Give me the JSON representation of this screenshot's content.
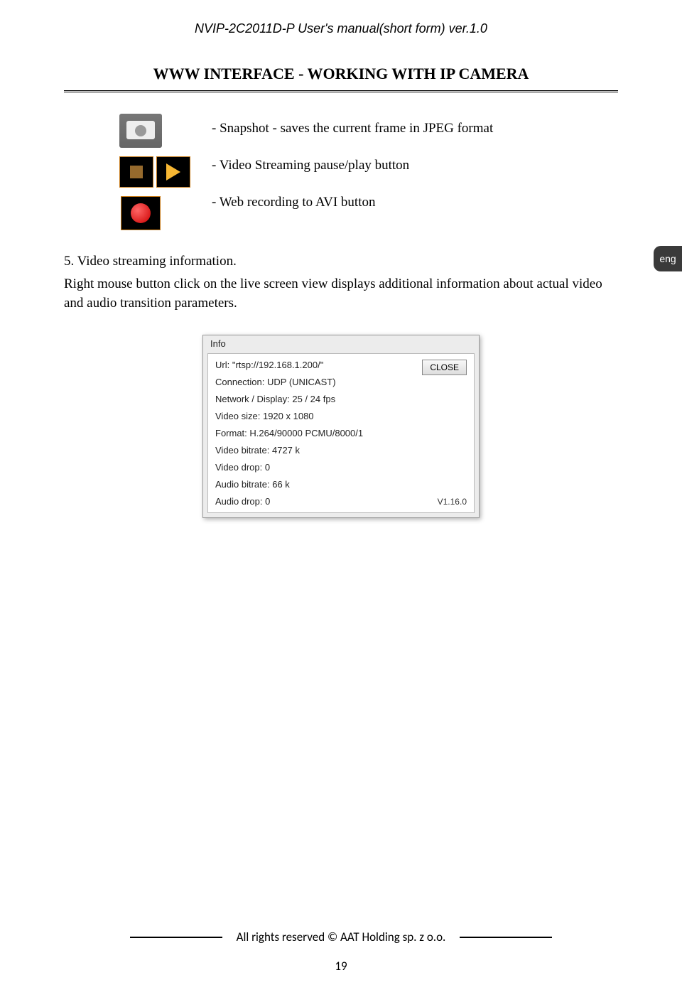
{
  "header": {
    "title": "NVIP-2C2011D-P User's manual(short form) ver.1.0"
  },
  "section": {
    "title": "WWW INTERFACE - WORKING WITH IP CAMERA"
  },
  "icons_text": {
    "snapshot": "- Snapshot - saves the current frame in JPEG format",
    "pauseplay": "- Video Streaming pause/play button",
    "record": "- Web recording to AVI button"
  },
  "body": {
    "heading": " 5. Video streaming information.",
    "para": "Right mouse button click on the live screen view displays additional information about actual video and audio transition parameters."
  },
  "lang_tab": "eng",
  "info_dialog": {
    "title": "Info",
    "rows": {
      "url": "Url: \"rtsp://192.168.1.200/\"",
      "connection": "Connection: UDP (UNICAST)",
      "network": "Network / Display:  25 / 24 fps",
      "videosize": "Video size: 1920 x 1080",
      "format": "Format: H.264/90000 PCMU/8000/1",
      "vbitrate": "Video bitrate: 4727 k",
      "vdrop": "Video drop: 0",
      "abitrate": "Audio bitrate: 66 k",
      "adrop": "Audio drop: 0"
    },
    "close_label": "CLOSE",
    "version": "V1.16.0"
  },
  "footer": {
    "copyright": "All rights reserved © AAT Holding sp. z o.o.",
    "page": "19"
  }
}
